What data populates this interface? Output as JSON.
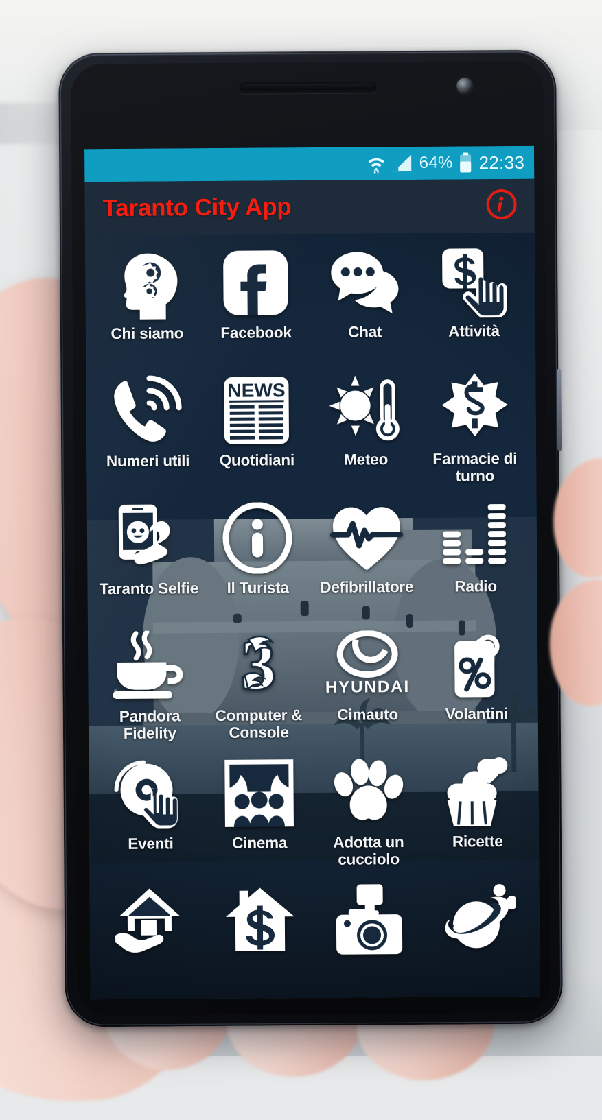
{
  "statusbar": {
    "wifi_icon": "wifi-icon",
    "signal_icon": "signal-bars-icon",
    "battery_percent": "64%",
    "battery_icon": "battery-icon",
    "time": "22:33",
    "background_color": "#0f9ec2"
  },
  "actionbar": {
    "title": "Taranto City App",
    "title_color": "#f41e10",
    "background_color": "#1d2b3b",
    "info_icon": "info-circle-icon"
  },
  "grid": {
    "background_color": "#16293d",
    "items": [
      {
        "label": "Chi siamo",
        "icon": "head-with-gears-icon"
      },
      {
        "label": "Facebook",
        "icon": "facebook-icon"
      },
      {
        "label": "Chat",
        "icon": "speech-bubbles-icon"
      },
      {
        "label": "Attività",
        "icon": "dollar-tap-hand-icon"
      },
      {
        "label": "Numeri utili",
        "icon": "ringing-phone-icon"
      },
      {
        "label": "Quotidiani",
        "icon": "newspaper-icon"
      },
      {
        "label": "Meteo",
        "icon": "sun-thermometer-icon"
      },
      {
        "label": "Farmacie di turno",
        "icon": "star-of-life-icon"
      },
      {
        "label": "Taranto Selfie",
        "icon": "selfie-phone-icon"
      },
      {
        "label": "Il Turista",
        "icon": "info-circle-outline-icon"
      },
      {
        "label": "Defibrillatore",
        "icon": "heart-pulse-icon"
      },
      {
        "label": "Radio",
        "icon": "equalizer-icon"
      },
      {
        "label": "Pandora Fidelity",
        "icon": "coffee-cup-icon"
      },
      {
        "label": "Computer & Console",
        "icon": "three-logo-icon"
      },
      {
        "label": "Cimauto",
        "icon": "hyundai-logo-icon"
      },
      {
        "label": "Volantini",
        "icon": "percent-tag-icon"
      },
      {
        "label": "Eventi",
        "icon": "dj-turntable-icon"
      },
      {
        "label": "Cinema",
        "icon": "theater-curtain-icon"
      },
      {
        "label": "Adotta un cucciolo",
        "icon": "paw-print-icon"
      },
      {
        "label": "Ricette",
        "icon": "cupcake-icon"
      },
      {
        "label": "",
        "icon": "house-in-hand-icon"
      },
      {
        "label": "",
        "icon": "house-dollar-icon"
      },
      {
        "label": "",
        "icon": "camera-flash-icon"
      },
      {
        "label": "",
        "icon": "planet-icon"
      }
    ]
  }
}
